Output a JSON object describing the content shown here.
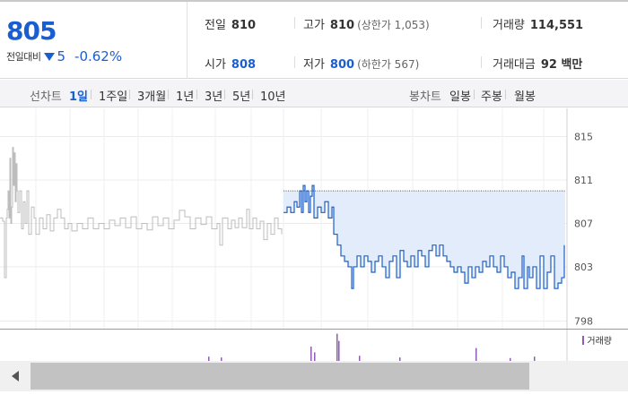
{
  "summary": {
    "price": "805",
    "change_label": "전일대비",
    "change_value": "5",
    "change_rate": "-0.62%",
    "prev": {
      "label": "전일",
      "value": "810"
    },
    "high": {
      "label": "고가",
      "value": "810",
      "sub": "(상한가 1,053)"
    },
    "volume": {
      "label": "거래량",
      "value": "114,551"
    },
    "open": {
      "label": "시가",
      "value": "808"
    },
    "low": {
      "label": "저가",
      "value": "800",
      "sub": "(하한가 567)"
    },
    "amount": {
      "label": "거래대금",
      "value": "92 백만"
    }
  },
  "toolbar": {
    "line_label": "선차트",
    "line_items": [
      "1일",
      "1주일",
      "3개월",
      "1년",
      "3년",
      "5년",
      "10년"
    ],
    "active_index": 0,
    "candle_label": "봉차트",
    "candle_items": [
      "일봉",
      "주봉",
      "월봉"
    ]
  },
  "colors": {
    "price_line": "#1a5fd0",
    "history_line": "#bdbdbd",
    "fill": "#e3ecfa",
    "volume": "#8e5bb5",
    "prev_line": "#555555"
  },
  "chart_data": {
    "type": "line",
    "yticks": [
      815,
      811,
      807,
      803,
      798
    ],
    "ylim": [
      797.3,
      817.6
    ],
    "prev_close": 810,
    "history": [
      [
        0,
        807.5
      ],
      [
        3,
        807.2
      ],
      [
        5,
        802.0
      ],
      [
        7,
        807.5
      ],
      [
        8,
        808.3
      ],
      [
        9,
        810.0
      ],
      [
        10,
        807.5
      ],
      [
        11,
        813.0
      ],
      [
        12,
        807.0
      ],
      [
        13,
        808.5
      ],
      [
        14,
        814.0
      ],
      [
        15,
        810.5
      ],
      [
        16,
        813.5
      ],
      [
        17,
        809.0
      ],
      [
        18,
        812.5
      ],
      [
        19,
        810.0
      ],
      [
        20,
        808.0
      ],
      [
        22,
        810.0
      ],
      [
        24,
        806.5
      ],
      [
        26,
        809.0
      ],
      [
        28,
        807.0
      ],
      [
        30,
        810.0
      ],
      [
        32,
        806.0
      ],
      [
        35,
        808.5
      ],
      [
        38,
        807.5
      ],
      [
        40,
        806.0
      ],
      [
        44,
        807.5
      ],
      [
        48,
        806.5
      ],
      [
        52,
        807.8
      ],
      [
        56,
        806.3
      ],
      [
        60,
        807.5
      ],
      [
        64,
        808.3
      ],
      [
        68,
        807.5
      ],
      [
        72,
        806.5
      ],
      [
        76,
        807.0
      ],
      [
        80,
        806.3
      ],
      [
        86,
        807.0
      ],
      [
        92,
        806.5
      ],
      [
        98,
        807.5
      ],
      [
        104,
        806.5
      ],
      [
        110,
        807.0
      ],
      [
        116,
        806.5
      ],
      [
        122,
        807.3
      ],
      [
        128,
        806.8
      ],
      [
        134,
        807.5
      ],
      [
        140,
        806.6
      ],
      [
        146,
        807.6
      ],
      [
        152,
        806.5
      ],
      [
        158,
        807.0
      ],
      [
        164,
        806.4
      ],
      [
        170,
        807.6
      ],
      [
        176,
        806.8
      ],
      [
        182,
        807.5
      ],
      [
        188,
        806.5
      ],
      [
        194,
        807.3
      ],
      [
        200,
        808.2
      ],
      [
        206,
        807.6
      ],
      [
        212,
        806.5
      ],
      [
        218,
        807.5
      ],
      [
        224,
        806.9
      ],
      [
        230,
        807.6
      ],
      [
        236,
        806.5
      ],
      [
        242,
        807.0
      ],
      [
        245,
        805.0
      ],
      [
        248,
        807.5
      ],
      [
        254,
        806.5
      ],
      [
        258,
        807.3
      ],
      [
        262,
        806.6
      ],
      [
        266,
        807.5
      ],
      [
        270,
        806.6
      ],
      [
        275,
        808.3
      ],
      [
        278,
        806.5
      ],
      [
        282,
        807.5
      ],
      [
        286,
        806.5
      ],
      [
        290,
        807.2
      ],
      [
        294,
        805.5
      ],
      [
        298,
        807.0
      ],
      [
        302,
        806.0
      ],
      [
        306,
        807.5
      ],
      [
        310,
        806.5
      ],
      [
        314,
        806.0
      ]
    ],
    "x_range": [
      0,
      632
    ],
    "today_start": 316,
    "today": [
      [
        316,
        808.0
      ],
      [
        320,
        808.5
      ],
      [
        324,
        808.0
      ],
      [
        328,
        809.0
      ],
      [
        331,
        808.5
      ],
      [
        334,
        810.0
      ],
      [
        336,
        808.0
      ],
      [
        338,
        810.5
      ],
      [
        340,
        809.0
      ],
      [
        342,
        810.0
      ],
      [
        344,
        808.0
      ],
      [
        346,
        809.5
      ],
      [
        348,
        810.5
      ],
      [
        350,
        807.5
      ],
      [
        354,
        808.5
      ],
      [
        358,
        808.0
      ],
      [
        362,
        809.0
      ],
      [
        366,
        807.5
      ],
      [
        370,
        808.5
      ],
      [
        372,
        806.0
      ],
      [
        376,
        805.0
      ],
      [
        380,
        804.0
      ],
      [
        384,
        803.5
      ],
      [
        388,
        803.0
      ],
      [
        392,
        801.0
      ],
      [
        394,
        803.0
      ],
      [
        398,
        804.0
      ],
      [
        402,
        803.0
      ],
      [
        406,
        804.0
      ],
      [
        410,
        803.5
      ],
      [
        414,
        802.5
      ],
      [
        418,
        803.5
      ],
      [
        422,
        804.0
      ],
      [
        426,
        803.0
      ],
      [
        430,
        802.0
      ],
      [
        434,
        803.5
      ],
      [
        438,
        804.0
      ],
      [
        442,
        802.0
      ],
      [
        446,
        804.5
      ],
      [
        450,
        803.5
      ],
      [
        454,
        803.0
      ],
      [
        458,
        804.0
      ],
      [
        462,
        803.0
      ],
      [
        466,
        804.5
      ],
      [
        470,
        804.0
      ],
      [
        474,
        803.0
      ],
      [
        478,
        804.5
      ],
      [
        482,
        805.0
      ],
      [
        486,
        804.0
      ],
      [
        490,
        805.0
      ],
      [
        494,
        804.0
      ],
      [
        498,
        803.5
      ],
      [
        502,
        803.0
      ],
      [
        506,
        802.5
      ],
      [
        510,
        803.0
      ],
      [
        514,
        802.5
      ],
      [
        518,
        801.5
      ],
      [
        522,
        803.0
      ],
      [
        526,
        802.0
      ],
      [
        530,
        803.0
      ],
      [
        534,
        802.5
      ],
      [
        538,
        803.5
      ],
      [
        542,
        803.0
      ],
      [
        546,
        804.0
      ],
      [
        550,
        803.0
      ],
      [
        554,
        802.5
      ],
      [
        558,
        804.0
      ],
      [
        562,
        803.0
      ],
      [
        566,
        802.0
      ],
      [
        570,
        802.5
      ],
      [
        574,
        801.0
      ],
      [
        578,
        802.0
      ],
      [
        582,
        804.0
      ],
      [
        584,
        801.0
      ],
      [
        588,
        803.0
      ],
      [
        590,
        802.0
      ],
      [
        594,
        803.0
      ],
      [
        598,
        801.0
      ],
      [
        602,
        804.0
      ],
      [
        606,
        801.0
      ],
      [
        610,
        802.5
      ],
      [
        614,
        804.0
      ],
      [
        618,
        801.0
      ],
      [
        622,
        801.5
      ],
      [
        626,
        802.0
      ],
      [
        629,
        805.0
      ]
    ],
    "volume_legend": "거래량",
    "volume": [
      [
        232,
        0.15
      ],
      [
        246,
        0.12
      ],
      [
        346,
        0.5
      ],
      [
        350,
        0.3
      ],
      [
        375,
        0.95
      ],
      [
        377,
        0.7
      ],
      [
        400,
        0.18
      ],
      [
        445,
        0.12
      ],
      [
        530,
        0.45
      ],
      [
        568,
        0.1
      ],
      [
        595,
        0.15
      ]
    ]
  }
}
